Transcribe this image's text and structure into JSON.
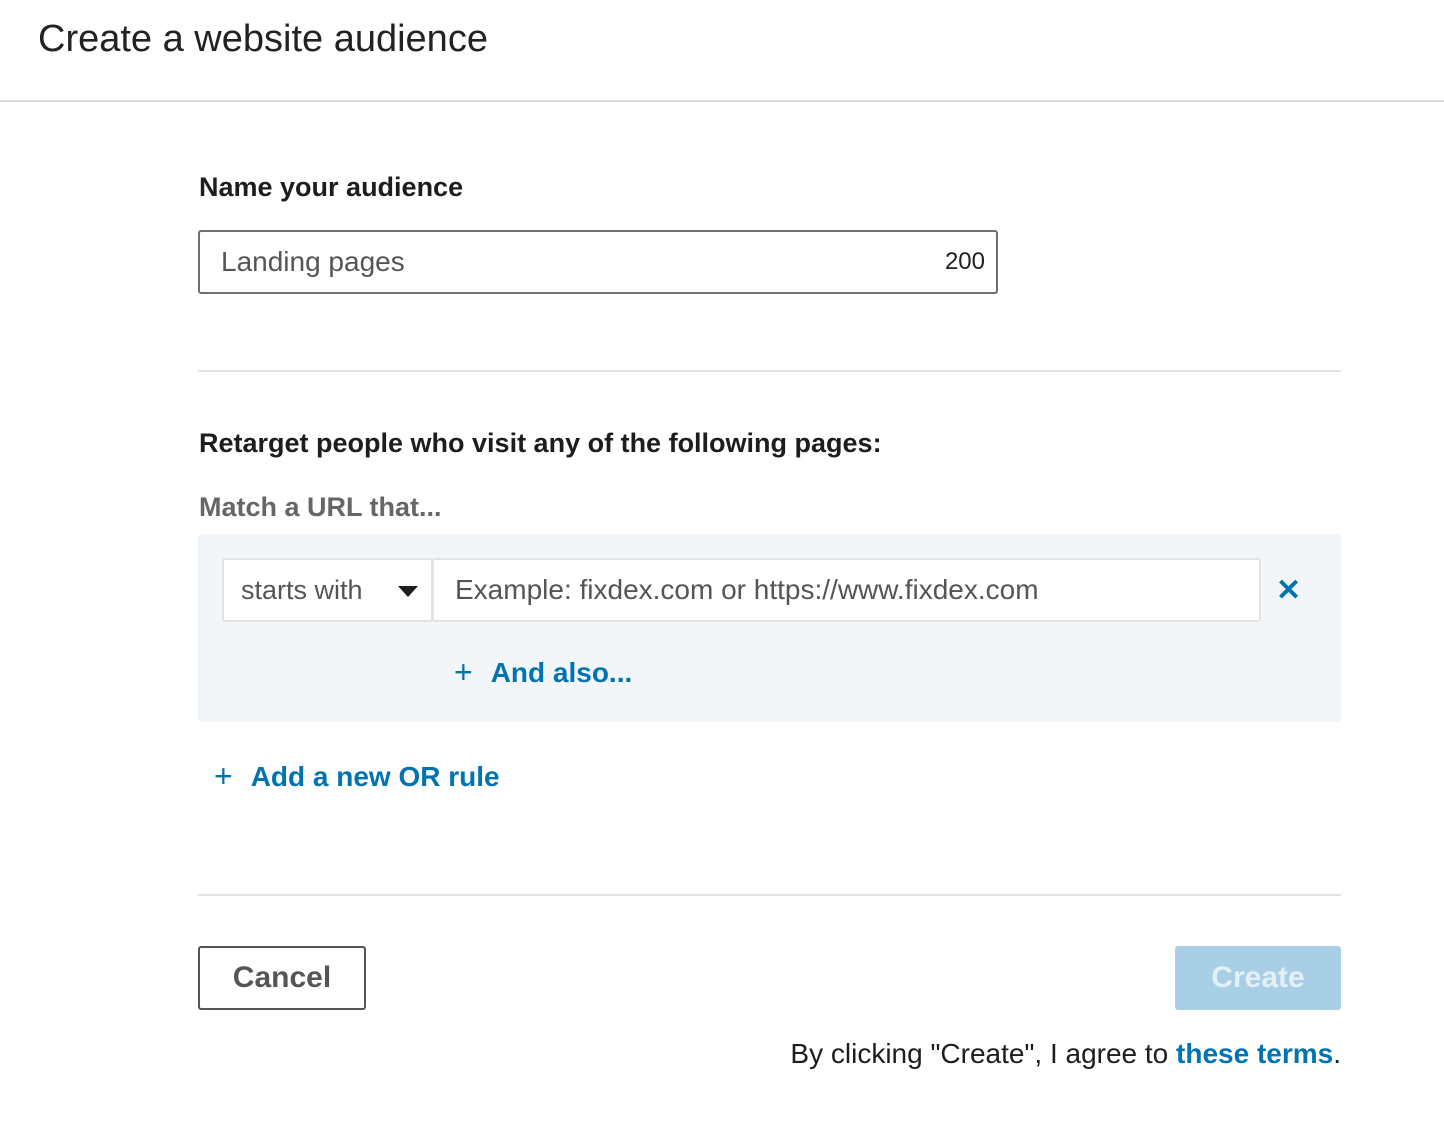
{
  "header": {
    "title": "Create a website audience"
  },
  "name_section": {
    "label": "Name your audience",
    "input_value": "Landing pages",
    "char_counter": "200"
  },
  "rules_section": {
    "heading": "Retarget people who visit any of the following pages:",
    "match_label": "Match a URL that...",
    "rule": {
      "match_type": "starts with",
      "url_placeholder": "Example: fixdex.com or https://www.fixdex.com",
      "remove_icon": "close-icon"
    },
    "and_also_label": "And also...",
    "add_or_rule_label": "Add a new OR rule",
    "plus_icon": "+"
  },
  "footer": {
    "cancel_label": "Cancel",
    "create_label": "Create",
    "terms_prefix": "By clicking \"Create\", I agree to ",
    "terms_link": "these terms",
    "terms_suffix": "."
  },
  "colors": {
    "accent": "#0073b1",
    "create_disabled_bg": "#a8cfe6",
    "rule_box_bg": "#f3f6f8"
  }
}
